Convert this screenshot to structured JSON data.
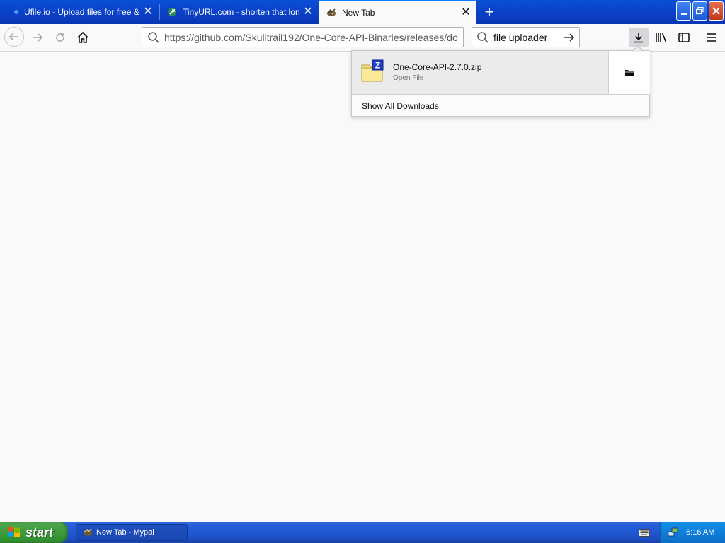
{
  "browser": {
    "tabs": [
      {
        "title": "Ufile.io - Upload files for free & sh",
        "active": false
      },
      {
        "title": "TinyURL.com - shorten that long U",
        "active": false
      },
      {
        "title": "New Tab",
        "active": true
      }
    ],
    "url": "https://github.com/Skulltrail192/One-Core-API-Binaries/releases/do",
    "search_value": "file uploader"
  },
  "downloads_panel": {
    "items": [
      {
        "filename": "One-Core-API-2.7.0.zip",
        "status": "Open File",
        "icon": "zip-archive-icon"
      }
    ],
    "show_all_label": "Show All Downloads"
  },
  "taskbar": {
    "start_label": "start",
    "tasks": [
      {
        "label": "New Tab - Mypal"
      }
    ],
    "clock": "6:16 AM"
  },
  "colors": {
    "xp_blue": "#245edb",
    "start_green": "#3c9b3b",
    "tray_blue": "#0f7ed9",
    "accent": "#0a84ff"
  }
}
